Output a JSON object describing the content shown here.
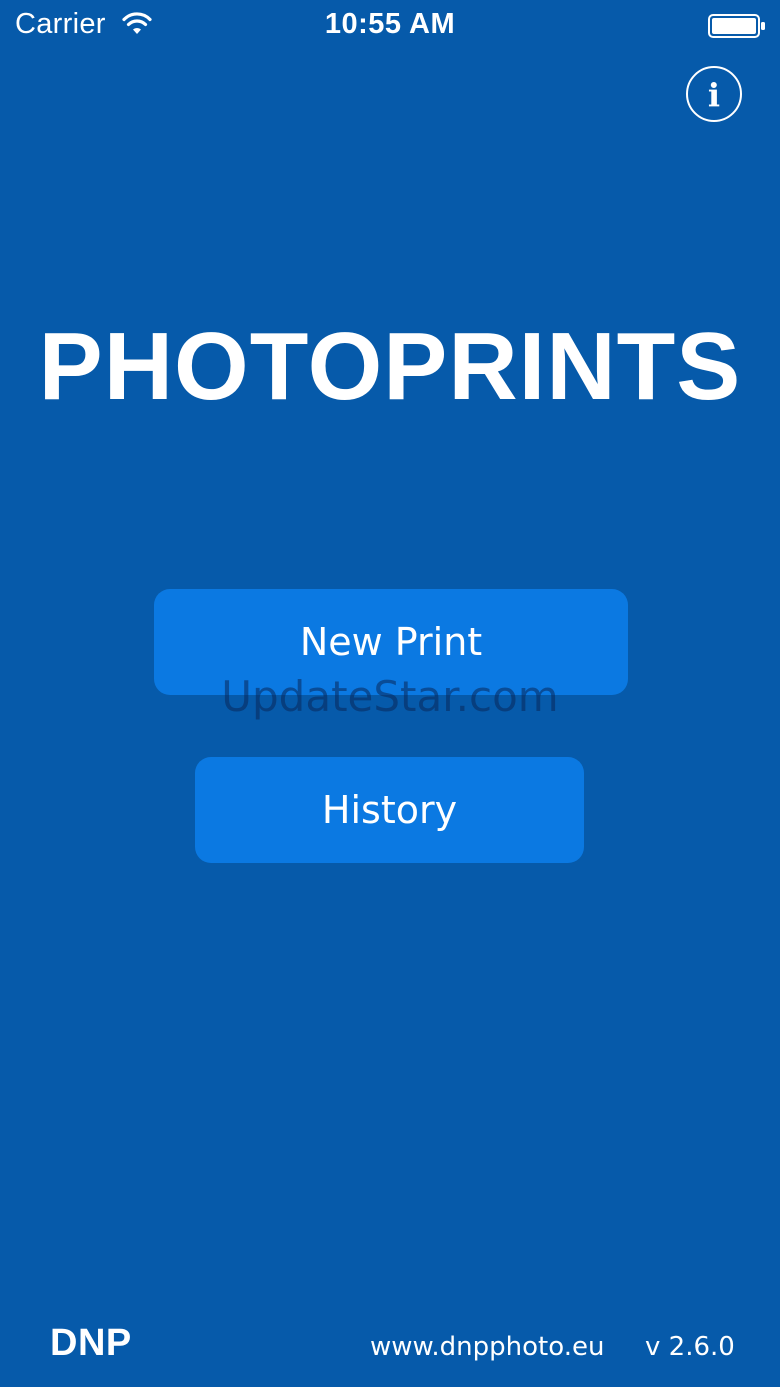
{
  "status_bar": {
    "carrier": "Carrier",
    "time": "10:55 AM",
    "wifi_icon": "wifi-icon",
    "battery_icon": "battery-full-icon"
  },
  "header": {
    "info_icon": "info-icon",
    "info_glyph": "i"
  },
  "main": {
    "title": "PHOTOPRINTS",
    "new_print_label": "New Print",
    "history_label": "History",
    "watermark": "UpdateStar.com"
  },
  "footer": {
    "brand": "DNP",
    "url": "www.dnpphoto.eu",
    "version": "v 2.6.0"
  },
  "colors": {
    "background": "#065aaa",
    "button": "#0b79e2",
    "text": "#ffffff"
  }
}
